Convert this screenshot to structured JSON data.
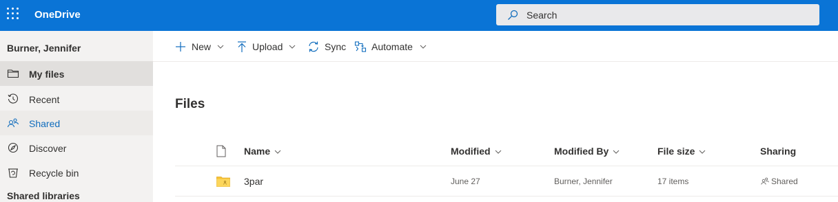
{
  "app": {
    "title": "OneDrive"
  },
  "search": {
    "placeholder": "Search"
  },
  "sidebar": {
    "user": "Burner, Jennifer",
    "items": [
      {
        "label": "My files",
        "icon": "folder-icon"
      },
      {
        "label": "Recent",
        "icon": "history-icon"
      },
      {
        "label": "Shared",
        "icon": "people-icon"
      },
      {
        "label": "Discover",
        "icon": "compass-icon"
      },
      {
        "label": "Recycle bin",
        "icon": "trash-icon"
      }
    ],
    "section_label": "Shared libraries"
  },
  "toolbar": {
    "new_label": "New",
    "upload_label": "Upload",
    "sync_label": "Sync",
    "automate_label": "Automate"
  },
  "main": {
    "title": "Files",
    "columns": {
      "name": "Name",
      "modified": "Modified",
      "modified_by": "Modified By",
      "file_size": "File size",
      "sharing": "Sharing"
    },
    "rows": [
      {
        "name": "3par",
        "modified": "June 27",
        "modified_by": "Burner, Jennifer",
        "file_size": "17 items",
        "sharing": "Shared"
      }
    ]
  },
  "colors": {
    "brand": "#0a74d6",
    "accent": "#0f6cbd",
    "folder": "#f8c334"
  }
}
